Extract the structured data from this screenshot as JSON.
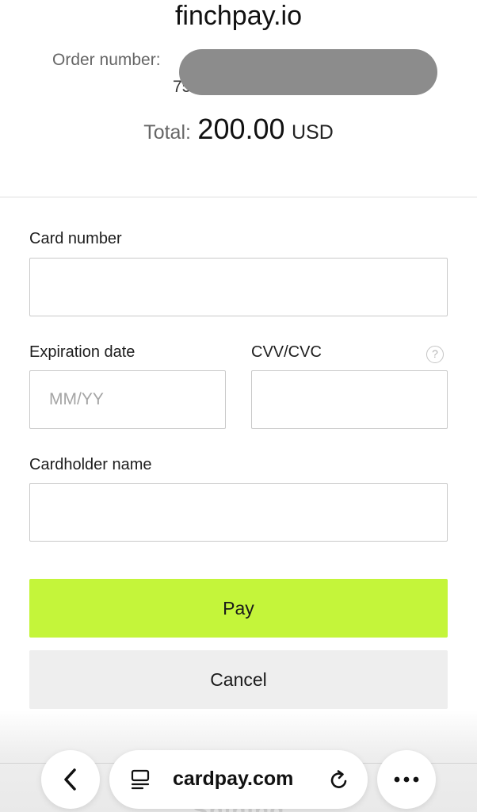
{
  "header": {
    "site_title": "finchpay.io",
    "order_label": "Order number:",
    "order_number_visible": "75",
    "total_label": "Total:",
    "total_amount": "200.00",
    "total_currency": "USD"
  },
  "form": {
    "card_number_label": "Card number",
    "card_number_value": "",
    "expiration_label": "Expiration date",
    "expiration_placeholder": "MM/YY",
    "cvv_label": "CVV/CVC",
    "cvv_help_glyph": "?",
    "cardholder_label": "Cardholder name",
    "cardholder_value": "",
    "pay_label": "Pay",
    "cancel_label": "Cancel"
  },
  "browser": {
    "url": "cardpay.com",
    "partially_hidden_text": "Shining"
  },
  "colors": {
    "pay_button": "#c4f53a",
    "cancel_button": "#eeeeee",
    "redaction": "#8c8c8c"
  },
  "icons": {
    "back": "chevron-left-icon",
    "reader": "reader-mode-icon",
    "reload": "reload-icon",
    "more": "more-horizontal-icon",
    "help": "question-circle-icon"
  }
}
